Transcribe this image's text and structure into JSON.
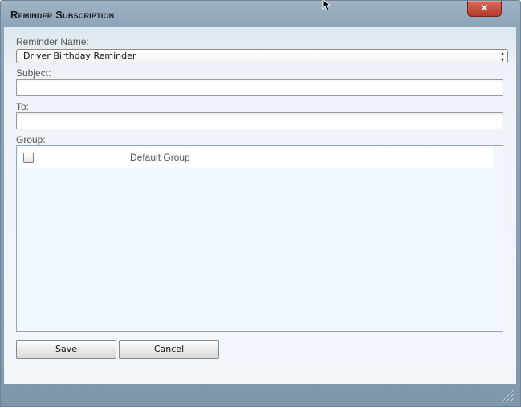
{
  "dialog": {
    "title": "Reminder Subscription",
    "close_label": "✕"
  },
  "form": {
    "reminder_name_label": "Reminder Name:",
    "reminder_name_value": "Driver Birthday Reminder",
    "subject_label": "Subject:",
    "subject_value": "",
    "to_label": "To:",
    "to_value": "",
    "group_label": "Group:",
    "groups": [
      {
        "name": "Default Group",
        "checked": false
      }
    ]
  },
  "buttons": {
    "save_label": "Save",
    "cancel_label": "Cancel"
  },
  "colors": {
    "frame": "#8fa6b9",
    "content_bg": "#f1f6fb",
    "close_button": "#c44a3a"
  }
}
